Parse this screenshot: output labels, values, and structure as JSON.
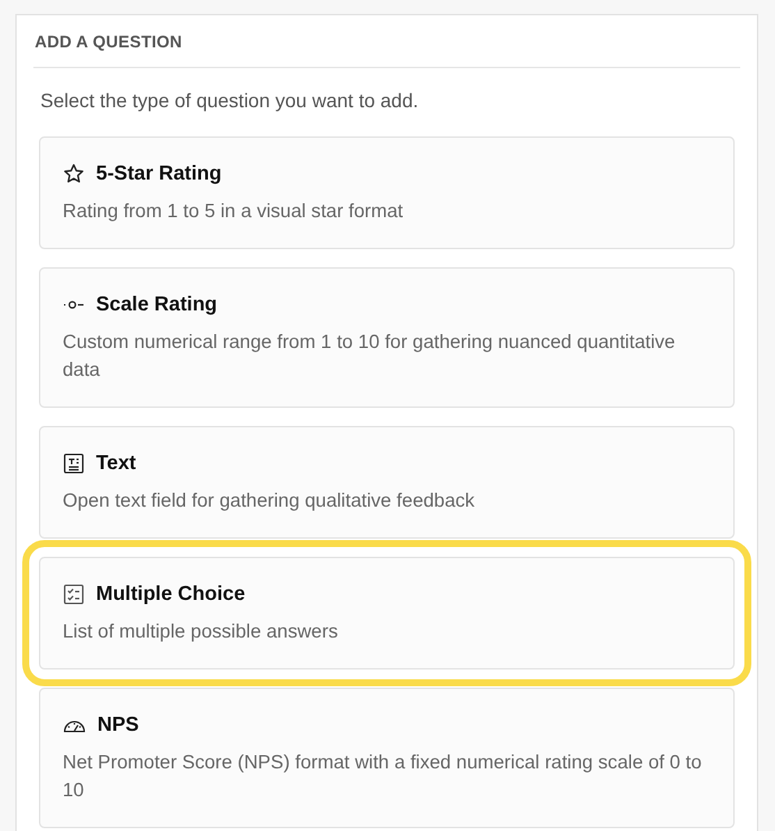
{
  "panel": {
    "title": "ADD A QUESTION",
    "subtitle": "Select the type of question you want to add."
  },
  "question_types": [
    {
      "kind": "star",
      "title": "5-Star Rating",
      "description": "Rating from 1 to 5 in a visual star format",
      "highlighted": false
    },
    {
      "kind": "scale",
      "title": "Scale Rating",
      "description": "Custom numerical range from 1 to 10 for gathering nuanced quantitative data",
      "highlighted": false
    },
    {
      "kind": "text",
      "title": "Text",
      "description": "Open text field for gathering qualitative feedback",
      "highlighted": false
    },
    {
      "kind": "choice",
      "title": "Multiple Choice",
      "description": "List of multiple possible answers",
      "highlighted": true
    },
    {
      "kind": "nps",
      "title": "NPS",
      "description": "Net Promoter Score (NPS) format with a fixed numerical rating scale of 0 to 10",
      "highlighted": false
    }
  ]
}
